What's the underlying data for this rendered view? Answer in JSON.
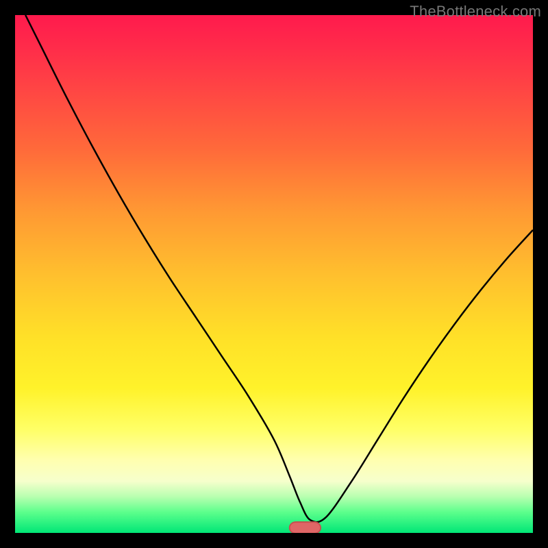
{
  "watermark": "TheBottleneck.com",
  "colors": {
    "frame_bg": "#000000",
    "curve": "#000000",
    "marker_fill": "#e06666",
    "marker_stroke": "#c74f4f",
    "gradient_top": "#ff1a4d",
    "gradient_bottom": "#00e676"
  },
  "chart_data": {
    "type": "line",
    "title": "",
    "xlabel": "",
    "ylabel": "",
    "xlim": [
      0,
      100
    ],
    "ylim": [
      0,
      100
    ],
    "grid": false,
    "legend": false,
    "series": [
      {
        "name": "bottleneck-curve",
        "x": [
          2,
          5,
          10,
          15,
          20,
          25,
          30,
          35,
          40,
          45,
          50,
          53,
          55,
          57,
          60,
          65,
          70,
          75,
          80,
          85,
          90,
          95,
          100
        ],
        "values": [
          100,
          94,
          84,
          74.5,
          65.5,
          57,
          49,
          41.5,
          34,
          26.5,
          18,
          11,
          6,
          2.5,
          3,
          10,
          18,
          26,
          33.5,
          40.5,
          47,
          53,
          58.5
        ]
      }
    ],
    "marker": {
      "name": "optimum-marker",
      "x_center": 56,
      "x_halfwidth": 3,
      "y": 1,
      "color": "#e06666",
      "shape": "pill"
    }
  }
}
